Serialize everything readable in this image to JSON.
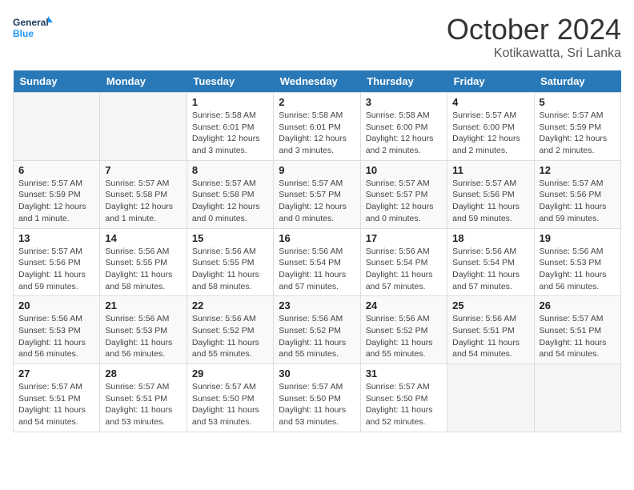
{
  "header": {
    "logo_general": "General",
    "logo_blue": "Blue",
    "month": "October 2024",
    "location": "Kotikawatta, Sri Lanka"
  },
  "days_of_week": [
    "Sunday",
    "Monday",
    "Tuesday",
    "Wednesday",
    "Thursday",
    "Friday",
    "Saturday"
  ],
  "weeks": [
    [
      {
        "day": "",
        "info": ""
      },
      {
        "day": "",
        "info": ""
      },
      {
        "day": "1",
        "info": "Sunrise: 5:58 AM\nSunset: 6:01 PM\nDaylight: 12 hours\nand 3 minutes."
      },
      {
        "day": "2",
        "info": "Sunrise: 5:58 AM\nSunset: 6:01 PM\nDaylight: 12 hours\nand 3 minutes."
      },
      {
        "day": "3",
        "info": "Sunrise: 5:58 AM\nSunset: 6:00 PM\nDaylight: 12 hours\nand 2 minutes."
      },
      {
        "day": "4",
        "info": "Sunrise: 5:57 AM\nSunset: 6:00 PM\nDaylight: 12 hours\nand 2 minutes."
      },
      {
        "day": "5",
        "info": "Sunrise: 5:57 AM\nSunset: 5:59 PM\nDaylight: 12 hours\nand 2 minutes."
      }
    ],
    [
      {
        "day": "6",
        "info": "Sunrise: 5:57 AM\nSunset: 5:59 PM\nDaylight: 12 hours\nand 1 minute."
      },
      {
        "day": "7",
        "info": "Sunrise: 5:57 AM\nSunset: 5:58 PM\nDaylight: 12 hours\nand 1 minute."
      },
      {
        "day": "8",
        "info": "Sunrise: 5:57 AM\nSunset: 5:58 PM\nDaylight: 12 hours\nand 0 minutes."
      },
      {
        "day": "9",
        "info": "Sunrise: 5:57 AM\nSunset: 5:57 PM\nDaylight: 12 hours\nand 0 minutes."
      },
      {
        "day": "10",
        "info": "Sunrise: 5:57 AM\nSunset: 5:57 PM\nDaylight: 12 hours\nand 0 minutes."
      },
      {
        "day": "11",
        "info": "Sunrise: 5:57 AM\nSunset: 5:56 PM\nDaylight: 11 hours\nand 59 minutes."
      },
      {
        "day": "12",
        "info": "Sunrise: 5:57 AM\nSunset: 5:56 PM\nDaylight: 11 hours\nand 59 minutes."
      }
    ],
    [
      {
        "day": "13",
        "info": "Sunrise: 5:57 AM\nSunset: 5:56 PM\nDaylight: 11 hours\nand 59 minutes."
      },
      {
        "day": "14",
        "info": "Sunrise: 5:56 AM\nSunset: 5:55 PM\nDaylight: 11 hours\nand 58 minutes."
      },
      {
        "day": "15",
        "info": "Sunrise: 5:56 AM\nSunset: 5:55 PM\nDaylight: 11 hours\nand 58 minutes."
      },
      {
        "day": "16",
        "info": "Sunrise: 5:56 AM\nSunset: 5:54 PM\nDaylight: 11 hours\nand 57 minutes."
      },
      {
        "day": "17",
        "info": "Sunrise: 5:56 AM\nSunset: 5:54 PM\nDaylight: 11 hours\nand 57 minutes."
      },
      {
        "day": "18",
        "info": "Sunrise: 5:56 AM\nSunset: 5:54 PM\nDaylight: 11 hours\nand 57 minutes."
      },
      {
        "day": "19",
        "info": "Sunrise: 5:56 AM\nSunset: 5:53 PM\nDaylight: 11 hours\nand 56 minutes."
      }
    ],
    [
      {
        "day": "20",
        "info": "Sunrise: 5:56 AM\nSunset: 5:53 PM\nDaylight: 11 hours\nand 56 minutes."
      },
      {
        "day": "21",
        "info": "Sunrise: 5:56 AM\nSunset: 5:53 PM\nDaylight: 11 hours\nand 56 minutes."
      },
      {
        "day": "22",
        "info": "Sunrise: 5:56 AM\nSunset: 5:52 PM\nDaylight: 11 hours\nand 55 minutes."
      },
      {
        "day": "23",
        "info": "Sunrise: 5:56 AM\nSunset: 5:52 PM\nDaylight: 11 hours\nand 55 minutes."
      },
      {
        "day": "24",
        "info": "Sunrise: 5:56 AM\nSunset: 5:52 PM\nDaylight: 11 hours\nand 55 minutes."
      },
      {
        "day": "25",
        "info": "Sunrise: 5:56 AM\nSunset: 5:51 PM\nDaylight: 11 hours\nand 54 minutes."
      },
      {
        "day": "26",
        "info": "Sunrise: 5:57 AM\nSunset: 5:51 PM\nDaylight: 11 hours\nand 54 minutes."
      }
    ],
    [
      {
        "day": "27",
        "info": "Sunrise: 5:57 AM\nSunset: 5:51 PM\nDaylight: 11 hours\nand 54 minutes."
      },
      {
        "day": "28",
        "info": "Sunrise: 5:57 AM\nSunset: 5:51 PM\nDaylight: 11 hours\nand 53 minutes."
      },
      {
        "day": "29",
        "info": "Sunrise: 5:57 AM\nSunset: 5:50 PM\nDaylight: 11 hours\nand 53 minutes."
      },
      {
        "day": "30",
        "info": "Sunrise: 5:57 AM\nSunset: 5:50 PM\nDaylight: 11 hours\nand 53 minutes."
      },
      {
        "day": "31",
        "info": "Sunrise: 5:57 AM\nSunset: 5:50 PM\nDaylight: 11 hours\nand 52 minutes."
      },
      {
        "day": "",
        "info": ""
      },
      {
        "day": "",
        "info": ""
      }
    ]
  ]
}
